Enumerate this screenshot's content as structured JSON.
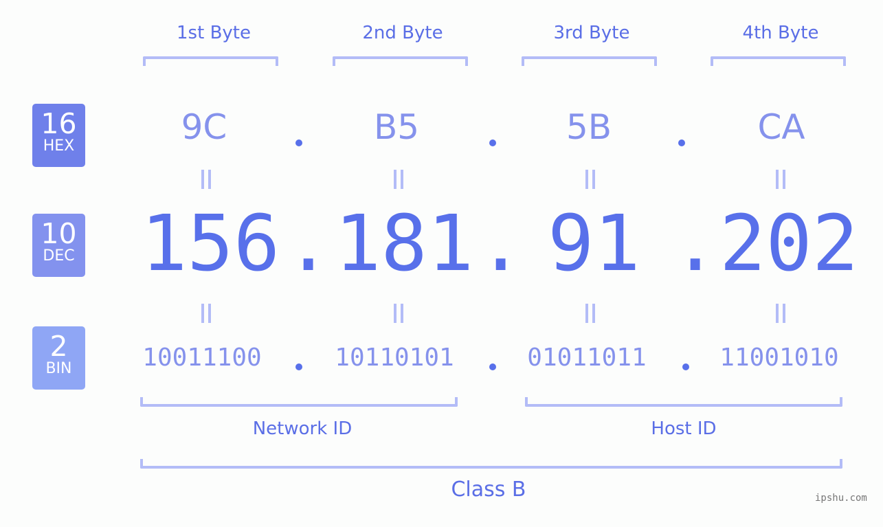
{
  "bytes": [
    {
      "label": "1st Byte",
      "hex": "9C",
      "dec": "156",
      "bin": "10011100"
    },
    {
      "label": "2nd Byte",
      "hex": "B5",
      "dec": "181",
      "bin": "10110101"
    },
    {
      "label": "3rd Byte",
      "hex": "5B",
      "dec": "91",
      "bin": "01011011"
    },
    {
      "label": "4th Byte",
      "hex": "CA",
      "dec": "202",
      "bin": "11001010"
    }
  ],
  "badges": {
    "hex": {
      "num": "16",
      "label": "HEX",
      "color": "#6f80ea"
    },
    "dec": {
      "num": "10",
      "label": "DEC",
      "color": "#8392ee"
    },
    "bin": {
      "num": "2",
      "label": "BIN",
      "color": "#8fa6f5"
    }
  },
  "groups": {
    "network": "Network ID",
    "host": "Host ID",
    "class": "Class B"
  },
  "watermark": "ipshu.com",
  "colors": {
    "accent": "#5870ea",
    "bracket": "#b3bcf7",
    "light_text": "#8592ec"
  }
}
